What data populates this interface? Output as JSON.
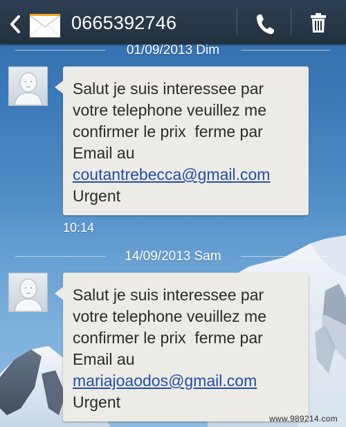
{
  "header": {
    "contact_number": "0665392746",
    "back_icon": "chevron-left-icon",
    "contact_icon": "envelope-icon",
    "call_icon": "phone-icon",
    "delete_icon": "trash-icon",
    "background_color": "#22313f"
  },
  "conversation": {
    "groups": [
      {
        "date": "01/09/2013 Dim",
        "message": {
          "line1": "Salut je suis interessee par",
          "line2": "votre telephone veuillez me",
          "line3": "confirmer le prix  ferme par",
          "line4": "Email au",
          "email": "coutantrebecca@gmail.com",
          "line6": "Urgent"
        },
        "time": "10:14"
      },
      {
        "date": "14/09/2013 Sam",
        "message": {
          "line1": "Salut je suis interessee par",
          "line2": "votre telephone veuillez me",
          "line3": "confirmer le prix  ferme par",
          "line4": "Email au",
          "email": "mariajoaodos@gmail.com",
          "line6": "Urgent"
        }
      }
    ]
  },
  "watermark": "www.989214.com",
  "colors": {
    "bubble": "#ecebe6",
    "link": "#1f4fa8",
    "sky": "#3b78b6"
  }
}
